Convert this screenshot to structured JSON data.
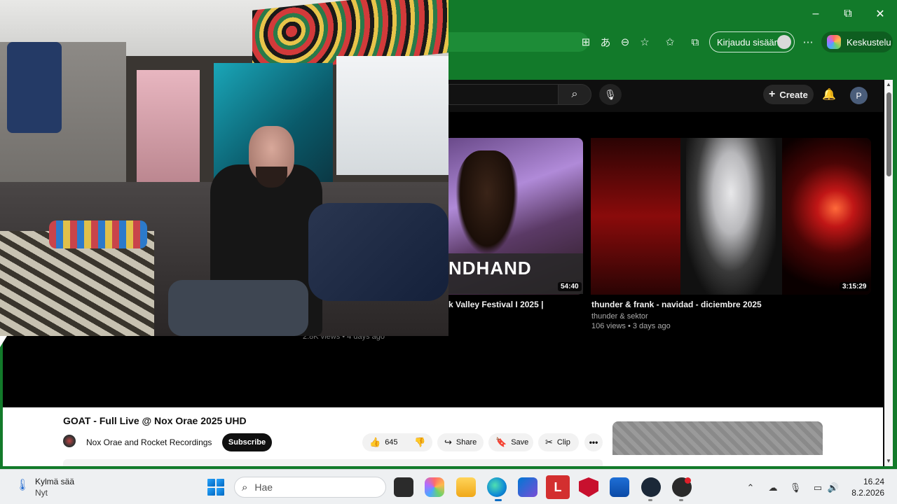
{
  "browser": {
    "signin_label": "Kirjaudu sisään",
    "copilot_label": "Keskustelu",
    "window_controls": {
      "minimize": "–",
      "restore": "⧉",
      "close": "✕"
    },
    "toolbar_icons": [
      "grid-icon",
      "translate-icon",
      "zoom-out-icon",
      "star-icon",
      "favorites-icon",
      "collections-icon",
      "more-icon"
    ]
  },
  "youtube": {
    "header": {
      "create_label": "Create",
      "avatar_letter": "P"
    },
    "recommendations": [
      {
        "thumb_text": "NDHAND",
        "duration": "54:40",
        "title": "k Valley Festival I 2025 |",
        "meta": "2.8K views • 4 days ago"
      },
      {
        "duration": "3:15:29",
        "title": "thunder & frank - navidad - diciembre 2025",
        "channel": "thunder & sektor",
        "meta": "106 views • 3 days ago"
      }
    ],
    "video": {
      "title": "GOAT - Full Live @ Nox Orae 2025 UHD",
      "channel": "Nox Orae and Rocket Recordings",
      "subscribe_label": "Subscribe",
      "likes": "645",
      "share_label": "Share",
      "save_label": "Save",
      "clip_label": "Clip",
      "more_label": "•••"
    }
  },
  "taskbar": {
    "weather_name": "Kylmä sää",
    "weather_sub": "Nyt",
    "search_placeholder": "Hae",
    "time": "16.24",
    "date": "8.2.2026",
    "app_letter_l": "L",
    "colors": {
      "edge": "#0e8ad6",
      "lastpass": "#d32f2f",
      "mcafee": "#c8102e",
      "steam": "#1b2838"
    }
  }
}
